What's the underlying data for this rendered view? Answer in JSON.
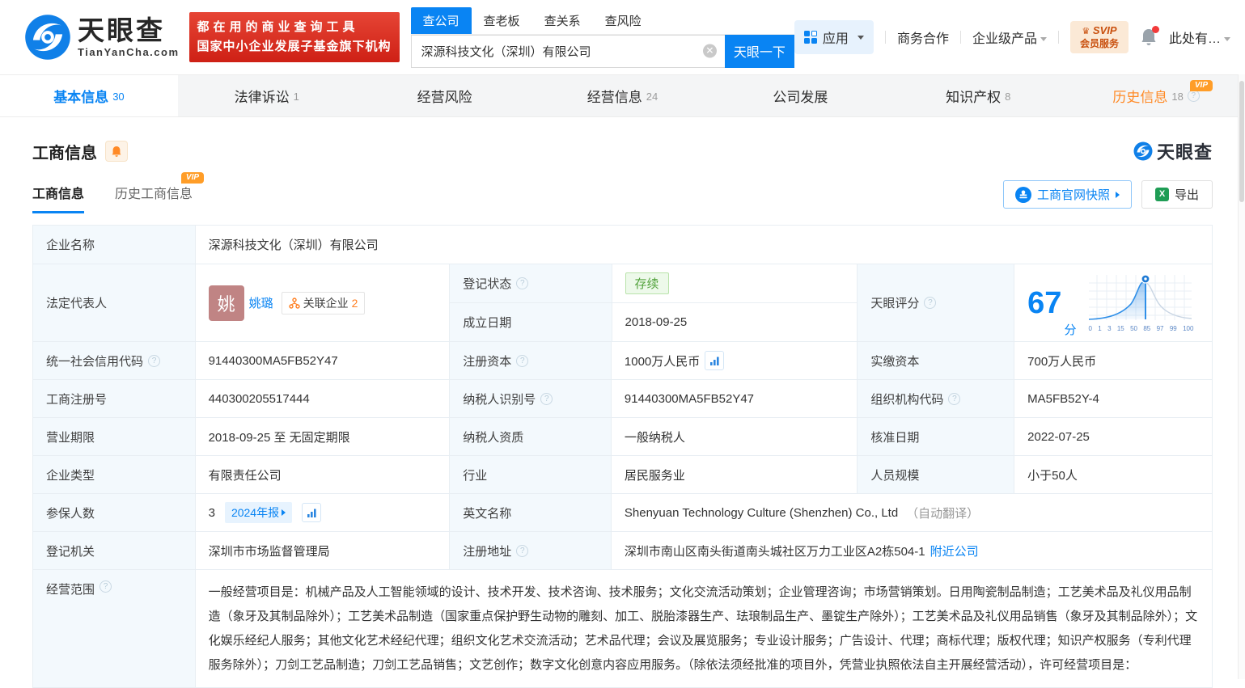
{
  "colors": {
    "accent": "#0984f3",
    "orange": "#ff8a26",
    "banner_red": "#d6261b",
    "status_green": "#52a23c"
  },
  "header": {
    "logo": {
      "brand": "天眼查",
      "domain": "TianYanCha.com"
    },
    "banner": {
      "line1": "都在用的商业查询工具",
      "line2": "国家中小企业发展子基金旗下机构"
    },
    "search": {
      "tabs": [
        {
          "label": "查公司"
        },
        {
          "label": "查老板"
        },
        {
          "label": "查关系"
        },
        {
          "label": "查风险"
        }
      ],
      "value": "深源科技文化（深圳）有限公司",
      "button": "天眼一下"
    },
    "nav": {
      "apps": "应用",
      "cooperation": "商务合作",
      "enterprise": "企业级产品",
      "svip_line1": "SVIP",
      "svip_line2": "会员服务",
      "user": "此处有…"
    }
  },
  "tabs": [
    {
      "label": "基本信息",
      "count": "30"
    },
    {
      "label": "法律诉讼",
      "count": "1"
    },
    {
      "label": "经营风险",
      "count": ""
    },
    {
      "label": "经营信息",
      "count": "24"
    },
    {
      "label": "公司发展",
      "count": ""
    },
    {
      "label": "知识产权",
      "count": "8"
    },
    {
      "label": "历史信息",
      "count": "18",
      "vip": "VIP"
    }
  ],
  "section": {
    "title": "工商信息",
    "watermark": "天眼查",
    "subtabs": [
      {
        "label": "工商信息"
      },
      {
        "label": "历史工商信息",
        "vip": "VIP"
      }
    ],
    "snapshot_button": "工商官网快照",
    "export_button": "导出"
  },
  "biz": {
    "company_name_label": "企业名称",
    "company_name": "深源科技文化（深圳）有限公司",
    "legal_rep_label": "法定代表人",
    "avatar_char": "姚",
    "legal_rep_name": "姚璐",
    "related_label": "关联企业",
    "related_count": "2",
    "status_label": "登记状态",
    "status_value": "存续",
    "established_label": "成立日期",
    "established_value": "2018-09-25",
    "score_label": "天眼评分",
    "score_value": "67",
    "score_unit": "分",
    "score_ticks": [
      "0",
      "1",
      "3",
      "15",
      "50",
      "85",
      "97",
      "99",
      "100"
    ],
    "uscc_label": "统一社会信用代码",
    "uscc_value": "91440300MA5FB52Y47",
    "reg_capital_label": "注册资本",
    "reg_capital_value": "1000万人民币",
    "paid_capital_label": "实缴资本",
    "paid_capital_value": "700万人民币",
    "reg_no_label": "工商注册号",
    "reg_no_value": "440300205517444",
    "taxpayer_id_label": "纳税人识别号",
    "taxpayer_id_value": "91440300MA5FB52Y47",
    "org_code_label": "组织机构代码",
    "org_code_value": "MA5FB52Y-4",
    "term_label": "营业期限",
    "term_value": "2018-09-25 至 无固定期限",
    "taxpayer_quality_label": "纳税人资质",
    "taxpayer_quality_value": "一般纳税人",
    "approval_date_label": "核准日期",
    "approval_date_value": "2022-07-25",
    "company_type_label": "企业类型",
    "company_type_value": "有限责任公司",
    "industry_label": "行业",
    "industry_value": "居民服务业",
    "staff_size_label": "人员规模",
    "staff_size_value": "小于50人",
    "insured_label": "参保人数",
    "insured_value": "3",
    "annual_report_chip": "2024年报",
    "en_name_label": "英文名称",
    "en_name_value": "Shenyuan Technology Culture (Shenzhen) Co., Ltd",
    "en_name_note": "（自动翻译）",
    "registry_label": "登记机关",
    "registry_value": "深圳市市场监督管理局",
    "address_label": "注册地址",
    "address_value": "深圳市南山区南头街道南头城社区万力工业区A2栋504-1",
    "nearby_link": "附近公司",
    "scope_label": "经营范围",
    "scope_value": "一般经营项目是：机械产品及人工智能领域的设计、技术开发、技术咨询、技术服务；文化交流活动策划；企业管理咨询；市场营销策划。日用陶瓷制品制造；工艺美术品及礼仪用品制造（象牙及其制品除外）；工艺美术品制造（国家重点保护野生动物的雕刻、加工、脱胎漆器生产、珐琅制品生产、墨锭生产除外）；工艺美术品及礼仪用品销售（象牙及其制品除外）；文化娱乐经纪人服务；其他文化艺术经纪代理；组织文化艺术交流活动；艺术品代理；会议及展览服务；专业设计服务；广告设计、代理；商标代理；版权代理；知识产权服务（专利代理服务除外）；刀剑工艺品制造；刀剑工艺品销售；文艺创作；数字文化创意内容应用服务。（除依法须经批准的项目外，凭营业执照依法自主开展经营活动），许可经营项目是："
  }
}
